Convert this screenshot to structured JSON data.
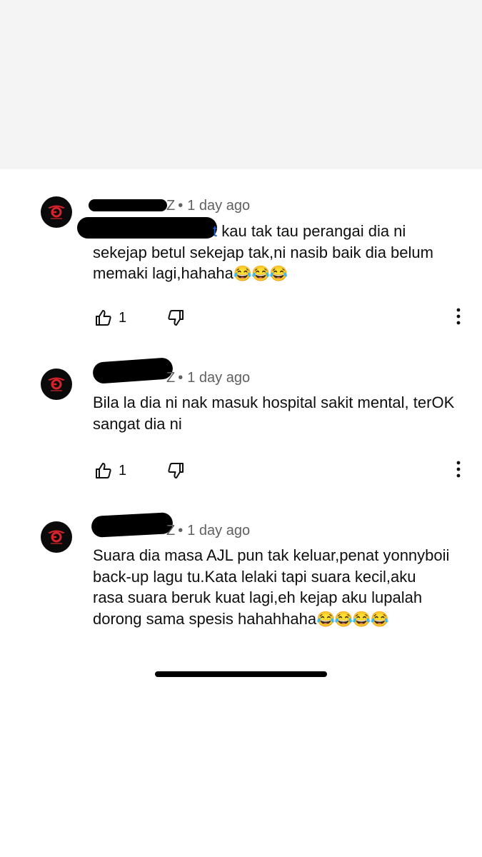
{
  "comments": [
    {
      "handle_visible": "Z",
      "separator": "•",
      "time": "1 day ago",
      "mention_visible": "t",
      "text": " kau tak tau perangai dia ni sekejap betul sekejap tak,ni nasib baik dia belum memaki lagi,hahaha",
      "emojis": "😂😂😂",
      "likes": "1",
      "avatar_icon": "garena-logo-icon"
    },
    {
      "handle_visible": "Z",
      "separator": "•",
      "time": "1 day ago",
      "text": "Bila la dia ni nak masuk hospital sakit mental, terOK sangat dia ni",
      "likes": "1",
      "avatar_icon": "garena-logo-icon"
    },
    {
      "handle_visible": "Z",
      "separator": "•",
      "time": "1 day ago",
      "text": "Suara dia masa AJL pun tak keluar,penat yonnyboii back-up lagu tu.Kata lelaki tapi suara kecil,aku rasa suara beruk kuat lagi,eh kejap aku lupalah dorong sama spesis hahahhaha",
      "emojis": "😂😂😂😂",
      "avatar_icon": "garena-logo-icon"
    }
  ],
  "colors": {
    "text": "#0f0f0f",
    "meta": "#606060",
    "mention": "#1a62d0",
    "avatar_bg": "#0a0a0a",
    "logo_red": "#d8232a"
  },
  "icons": [
    "thumbs-up-icon",
    "thumbs-down-icon",
    "more-vertical-icon"
  ]
}
